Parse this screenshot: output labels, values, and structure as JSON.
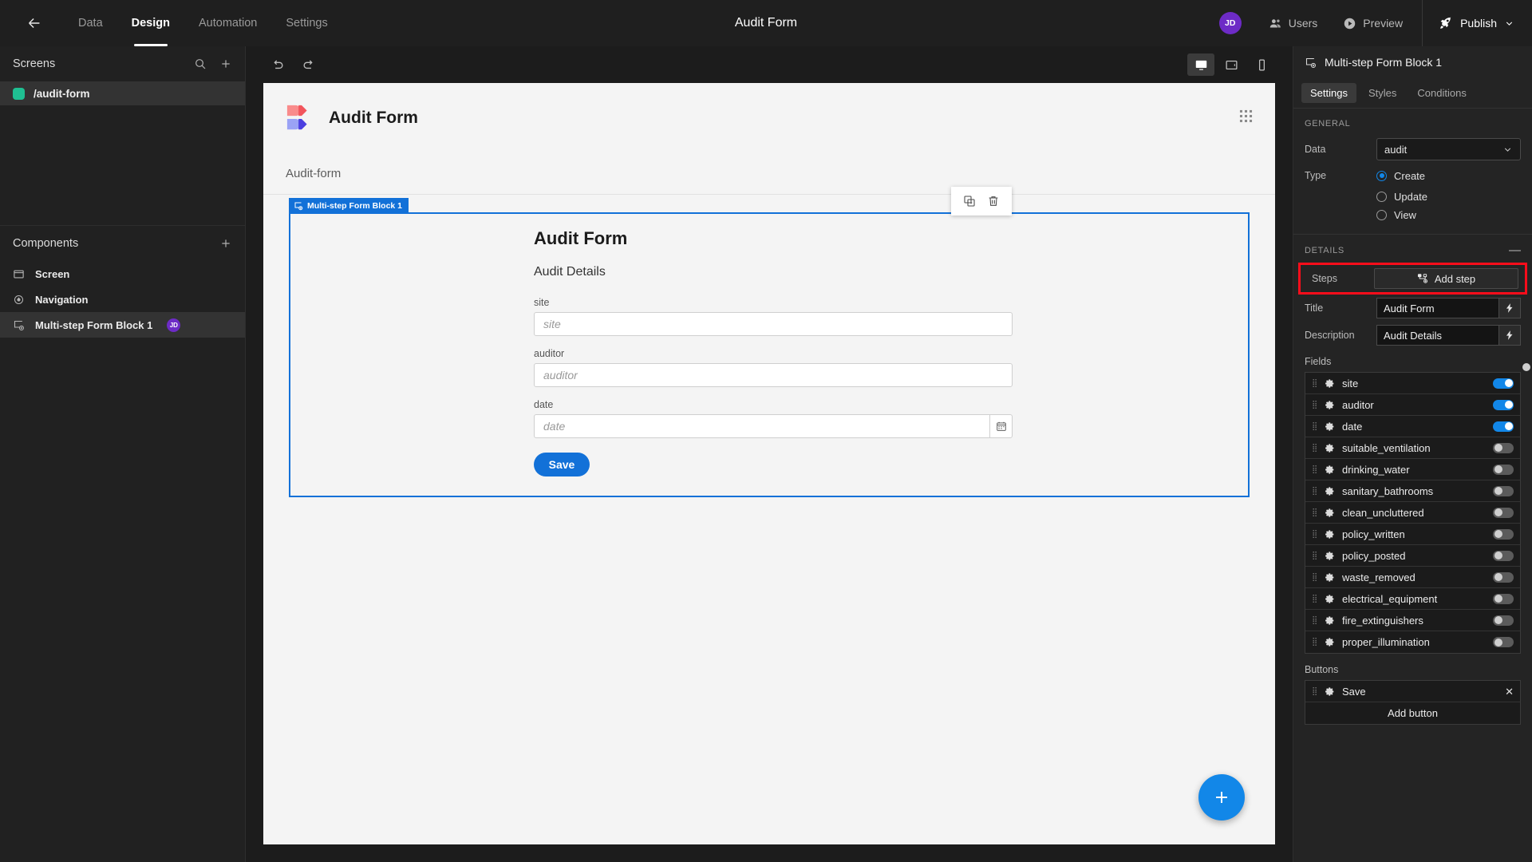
{
  "topbar": {
    "back_icon": "arrow-left-icon",
    "nav": [
      {
        "label": "Data",
        "active": false
      },
      {
        "label": "Design",
        "active": true
      },
      {
        "label": "Automation",
        "active": false
      },
      {
        "label": "Settings",
        "active": false
      }
    ],
    "title": "Audit Form",
    "avatar_initials": "JD",
    "users_label": "Users",
    "preview_label": "Preview",
    "publish_label": "Publish"
  },
  "sidebar": {
    "screens_title": "Screens",
    "search_icon": "search-icon",
    "add_icon": "plus-icon",
    "screens": [
      {
        "label": "/audit-form",
        "color": "#1fbf92",
        "selected": true
      }
    ],
    "components_title": "Components",
    "components_add_icon": "plus-icon",
    "components": [
      {
        "label": "Screen",
        "icon": "screen-icon",
        "selected": false,
        "badge": ""
      },
      {
        "label": "Navigation",
        "icon": "eye-icon",
        "selected": false,
        "badge": ""
      },
      {
        "label": "Multi-step Form Block 1",
        "icon": "form-block-icon",
        "selected": true,
        "badge": "JD"
      }
    ]
  },
  "canvas": {
    "undo_icon": "undo-icon",
    "redo_icon": "redo-icon",
    "devices": [
      {
        "name": "desktop-icon",
        "active": true
      },
      {
        "name": "tablet-icon",
        "active": false
      },
      {
        "name": "mobile-icon",
        "active": false
      }
    ],
    "brand_title": "Audit Form",
    "grid_icon": "grid-dots-icon",
    "breadcrumb": "Audit-form",
    "float_tools": [
      {
        "name": "duplicate-icon"
      },
      {
        "name": "delete-icon"
      }
    ],
    "block_tag": "Multi-step Form Block 1",
    "form": {
      "title": "Audit Form",
      "subtitle": "Audit Details",
      "fields": [
        {
          "label": "site",
          "placeholder": "site",
          "type": "text"
        },
        {
          "label": "auditor",
          "placeholder": "auditor",
          "type": "text"
        },
        {
          "label": "date",
          "placeholder": "date",
          "type": "date"
        }
      ],
      "save_label": "Save"
    },
    "fab_icon": "plus-icon"
  },
  "rightpanel": {
    "header_title": "Multi-step Form Block 1",
    "header_icon": "form-block-icon",
    "tabs": [
      {
        "label": "Settings",
        "active": true
      },
      {
        "label": "Styles",
        "active": false
      },
      {
        "label": "Conditions",
        "active": false
      }
    ],
    "general_title": "GENERAL",
    "data_label": "Data",
    "data_value": "audit",
    "type_label": "Type",
    "type_options": [
      {
        "label": "Create",
        "selected": true
      },
      {
        "label": "Update",
        "selected": false
      },
      {
        "label": "View",
        "selected": false
      }
    ],
    "details_title": "DETAILS",
    "collapse_icon": "minus-icon",
    "steps_label": "Steps",
    "add_step_label": "Add step",
    "add_step_icon": "add-step-icon",
    "highlight_color": "#fb0d1b",
    "accent_color": "#1287e8",
    "title_label": "Title",
    "title_value": "Audit Form",
    "description_label": "Description",
    "description_value": "Audit Details",
    "bolt_icon": "lightning-icon",
    "fields_label": "Fields",
    "fields_master_on": false,
    "fields": [
      {
        "label": "site",
        "on": true
      },
      {
        "label": "auditor",
        "on": true
      },
      {
        "label": "date",
        "on": true
      },
      {
        "label": "suitable_ventilation",
        "on": false
      },
      {
        "label": "drinking_water",
        "on": false
      },
      {
        "label": "sanitary_bathrooms",
        "on": false
      },
      {
        "label": "clean_uncluttered",
        "on": false
      },
      {
        "label": "policy_written",
        "on": false
      },
      {
        "label": "policy_posted",
        "on": false
      },
      {
        "label": "waste_removed",
        "on": false
      },
      {
        "label": "electrical_equipment",
        "on": false
      },
      {
        "label": "fire_extinguishers",
        "on": false
      },
      {
        "label": "proper_illumination",
        "on": false
      }
    ],
    "buttons_label": "Buttons",
    "buttons": [
      {
        "label": "Save"
      }
    ],
    "add_button_label": "Add button"
  }
}
